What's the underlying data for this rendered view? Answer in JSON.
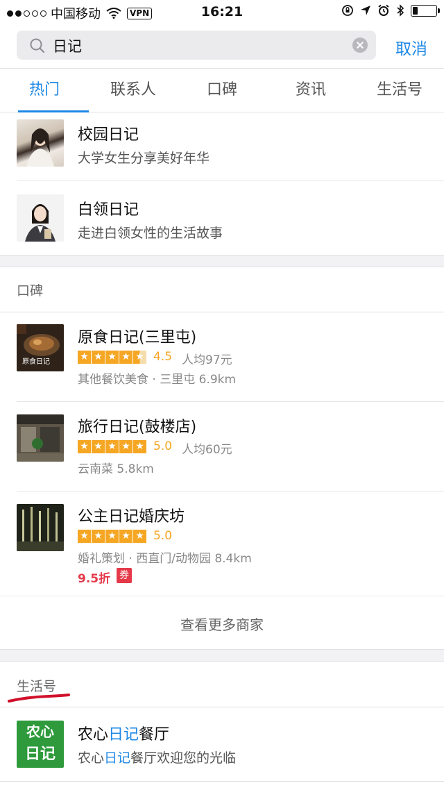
{
  "status_bar": {
    "carrier": "中国移动",
    "vpn": "VPN",
    "time": "16:21"
  },
  "search": {
    "value": "日记",
    "cancel_label": "取消"
  },
  "tabs": [
    {
      "label": "热门",
      "active": true
    },
    {
      "label": "联系人",
      "active": false
    },
    {
      "label": "口碑",
      "active": false
    },
    {
      "label": "资讯",
      "active": false
    },
    {
      "label": "生活号",
      "active": false
    }
  ],
  "top_results": [
    {
      "title": "校园日记",
      "subtitle": "大学女生分享美好年华"
    },
    {
      "title": "白领日记",
      "subtitle": "走进白领女性的生活故事"
    }
  ],
  "koubei": {
    "section_label": "口碑",
    "merchants": [
      {
        "title": "原食日记(三里屯)",
        "rating": "4.5",
        "stars": 4.5,
        "price": "人均97元",
        "meta": "其他餐饮美食 · 三里屯 6.9km",
        "thumb_text": "原食日记"
      },
      {
        "title": "旅行日记(鼓楼店)",
        "rating": "5.0",
        "stars": 5,
        "price": "人均60元",
        "meta": "云南菜 5.8km"
      },
      {
        "title": "公主日记婚庆坊",
        "rating": "5.0",
        "stars": 5,
        "price": "",
        "meta": "婚礼策划 · 西直门/动物园 8.4km",
        "discount": "9.5折",
        "coupon": "券"
      }
    ],
    "more_label": "查看更多商家"
  },
  "life_accounts": {
    "section_label": "生活号",
    "items": [
      {
        "title_prefix": "农心",
        "title_highlight": "日记",
        "title_suffix": "餐厅",
        "sub_prefix": "农心",
        "sub_highlight": "日记",
        "sub_suffix": "餐厅欢迎您的光临",
        "logo_line1": "农心",
        "logo_line2": "日记"
      }
    ]
  },
  "colors": {
    "accent": "#1e88e5",
    "star": "#f5a623",
    "discount": "#e5394a",
    "logo_green": "#2e9a3c",
    "annotation_red": "#d0102a"
  }
}
